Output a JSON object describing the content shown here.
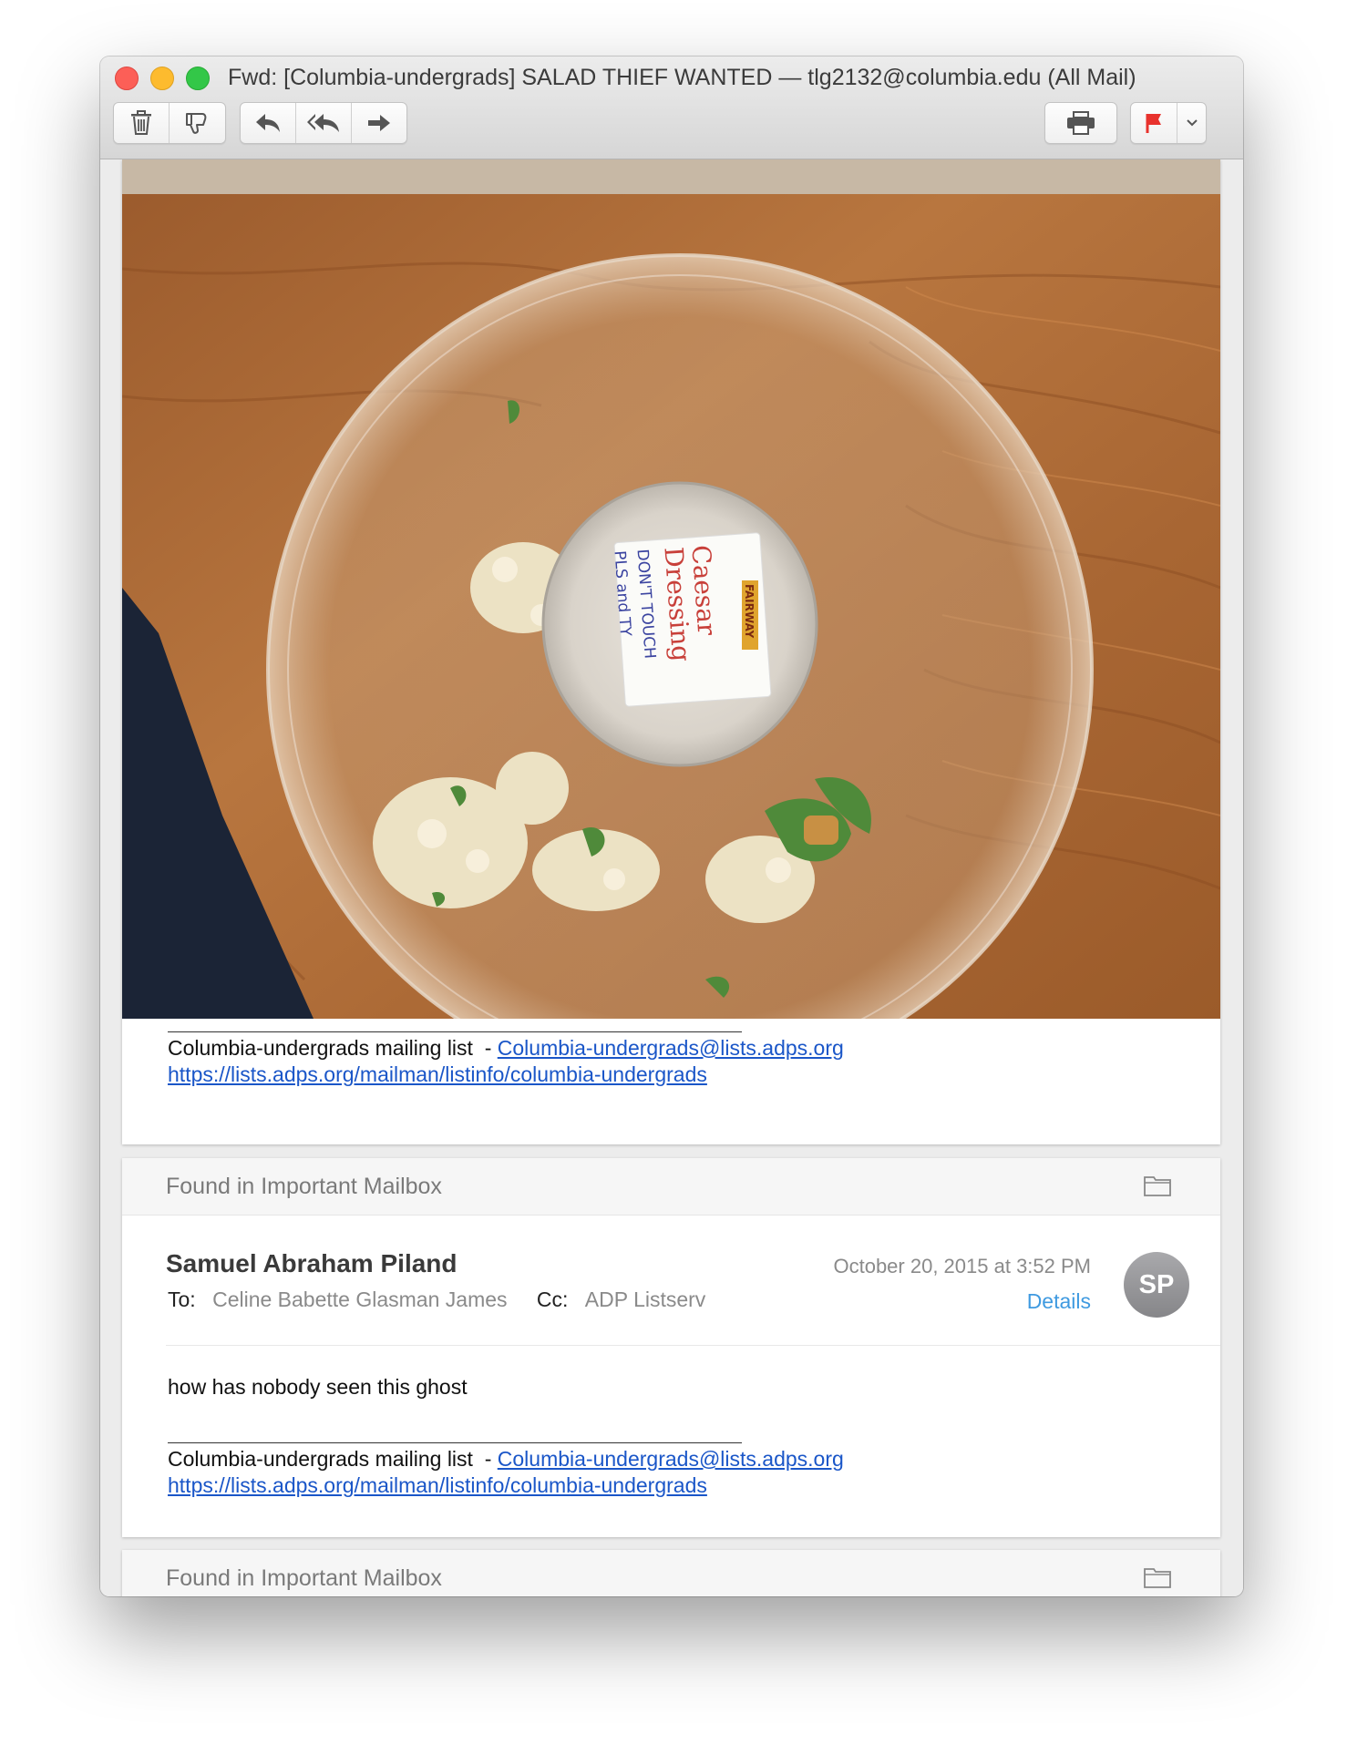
{
  "window": {
    "title": "Fwd: [Columbia-undergrads] SALAD THIEF WANTED — tlg2132@columbia.edu (All Mail)"
  },
  "toolbar": {
    "icons": [
      "trash-icon",
      "junk-icon",
      "reply-icon",
      "reply-all-icon",
      "forward-icon",
      "print-icon",
      "flag-icon",
      "chevron-down-icon"
    ],
    "flag_color": "#e8322d"
  },
  "photo": {
    "label_lines": [
      "Caesar",
      "Dressing",
      "DON'T TOUCH",
      "PLS and TY"
    ],
    "sticker_text": "FAIRWAY"
  },
  "message1": {
    "footer": {
      "list_prefix": "Columbia-undergrads mailing list  - ",
      "list_email": "Columbia-undergrads@lists.adps.org",
      "list_url": "https://lists.adps.org/mailman/listinfo/columbia-undergrads"
    }
  },
  "message2": {
    "found_in": "Found in Important Mailbox",
    "sender": "Samuel Abraham Piland",
    "to_label": "To:",
    "to_value": "Celine Babette Glasman James",
    "cc_label": "Cc:",
    "cc_value": "ADP Listserv",
    "date": "October 20, 2015 at 3:52 PM",
    "details_label": "Details",
    "avatar_initials": "SP",
    "body": "how has nobody seen this ghost",
    "footer": {
      "list_prefix": "Columbia-undergrads mailing list  - ",
      "list_email": "Columbia-undergrads@lists.adps.org",
      "list_url": "https://lists.adps.org/mailman/listinfo/columbia-undergrads"
    }
  },
  "message3": {
    "found_in": "Found in Important Mailbox"
  },
  "colors": {
    "link": "#1a56c8",
    "details": "#3f9ae0",
    "avatar": "#98989b"
  }
}
